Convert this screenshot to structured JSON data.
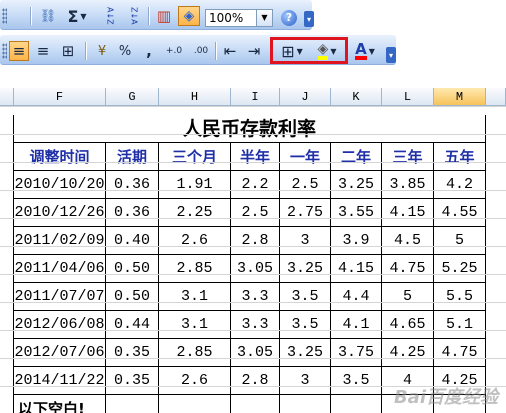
{
  "toolbar1": {
    "zoom_value": "100%",
    "buttons": [
      {
        "name": "hyperlink-icon",
        "glyph": "⛓"
      },
      {
        "name": "autosum-icon",
        "glyph": "Σ"
      },
      {
        "name": "sort-ascending-icon",
        "glyph": "A↓Z"
      },
      {
        "name": "sort-descending-icon",
        "glyph": "Z↓A"
      },
      {
        "name": "chart-wizard-icon",
        "glyph": "▥"
      },
      {
        "name": "drawing-icon",
        "glyph": "◈"
      }
    ],
    "help_glyph": "?"
  },
  "toolbar2": {
    "buttons": [
      {
        "name": "align-left-icon",
        "glyph": "≡"
      },
      {
        "name": "align-center-icon",
        "glyph": "≡"
      },
      {
        "name": "merge-center-icon",
        "glyph": "⊞"
      },
      {
        "name": "currency-icon",
        "glyph": "¥"
      },
      {
        "name": "percent-icon",
        "glyph": "%"
      },
      {
        "name": "comma-style-icon",
        "glyph": ","
      },
      {
        "name": "increase-decimal-icon",
        "glyph": "+.0"
      },
      {
        "name": "decrease-decimal-icon",
        "glyph": ".00"
      },
      {
        "name": "decrease-indent-icon",
        "glyph": "⇤"
      },
      {
        "name": "increase-indent-icon",
        "glyph": "⇥"
      },
      {
        "name": "borders-icon",
        "glyph": "⊞"
      },
      {
        "name": "fill-color-icon",
        "glyph": "◈"
      },
      {
        "name": "font-color-icon",
        "glyph": "A"
      }
    ]
  },
  "colors": {
    "header_text": "#1f2fa8",
    "highlight_box": "#e0141e",
    "active_column": "#f7c25a",
    "fill_color_swatch": "#ffff00",
    "font_color_swatch": "#ff0000"
  },
  "sheet": {
    "columns": [
      "F",
      "G",
      "H",
      "I",
      "J",
      "K",
      "L",
      "M"
    ],
    "active_column": "M",
    "title": "人民币存款利率",
    "headers": [
      "调整时间",
      "活期",
      "三个月",
      "半年",
      "一年",
      "二年",
      "三年",
      "五年"
    ],
    "rows": [
      [
        "2010/10/20",
        "0.36",
        "1.91",
        "2.2",
        "2.5",
        "3.25",
        "3.85",
        "4.2"
      ],
      [
        "2010/12/26",
        "0.36",
        "2.25",
        "2.5",
        "2.75",
        "3.55",
        "4.15",
        "4.55"
      ],
      [
        "2011/02/09",
        "0.40",
        "2.6",
        "2.8",
        "3",
        "3.9",
        "4.5",
        "5"
      ],
      [
        "2011/04/06",
        "0.50",
        "2.85",
        "3.05",
        "3.25",
        "4.15",
        "4.75",
        "5.25"
      ],
      [
        "2011/07/07",
        "0.50",
        "3.1",
        "3.3",
        "3.5",
        "4.4",
        "5",
        "5.5"
      ],
      [
        "2012/06/08",
        "0.44",
        "3.1",
        "3.3",
        "3.5",
        "4.1",
        "4.65",
        "5.1"
      ],
      [
        "2012/07/06",
        "0.35",
        "2.85",
        "3.05",
        "3.25",
        "3.75",
        "4.25",
        "4.75"
      ],
      [
        "2014/11/22",
        "0.35",
        "2.6",
        "2.8",
        "3",
        "3.5",
        "4",
        "4.25"
      ]
    ],
    "footer_note": "以下空白!"
  },
  "watermark": "Bai百度经验"
}
